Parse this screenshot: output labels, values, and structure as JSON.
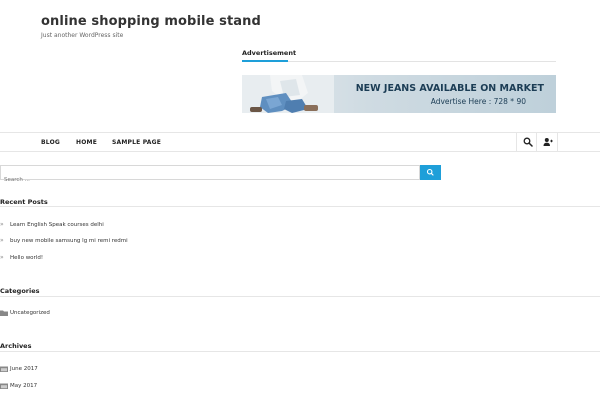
{
  "site": {
    "title": "online shopping mobile stand",
    "tagline": "Just another WordPress site"
  },
  "advertisement": {
    "label": "Advertisement",
    "headline": "NEW JEANS AVAILABLE ON MARKET",
    "subline": "Advertise Here : 728 * 90"
  },
  "nav": {
    "items": [
      {
        "label": "BLOG"
      },
      {
        "label": "HOME"
      },
      {
        "label": "SAMPLE PAGE"
      }
    ],
    "icons": [
      "search-icon",
      "user-add-icon"
    ]
  },
  "search": {
    "placeholder": "Search ..."
  },
  "recent_posts": {
    "title": "Recent Posts",
    "items": [
      "Learn English Speak courses delhi",
      "buy new mobile samsung lg mi remi redmi",
      "Hello world!"
    ]
  },
  "categories": {
    "title": "Categories",
    "items": [
      "Uncategorized"
    ]
  },
  "archives": {
    "title": "Archives",
    "items": [
      "June 2017",
      "May 2017"
    ]
  },
  "colors": {
    "accent": "#1e9fd9",
    "text": "#333333"
  }
}
